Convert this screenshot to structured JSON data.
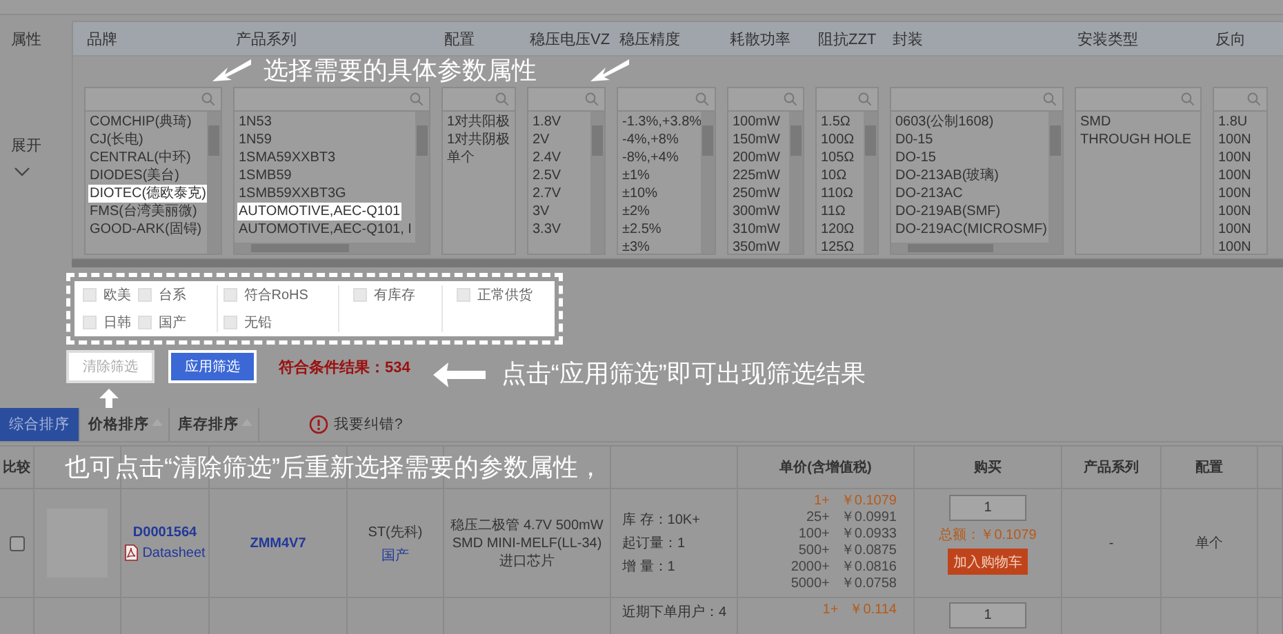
{
  "sidebar": {
    "attribute_label": "属性",
    "expand_label": "展开"
  },
  "filters": [
    {
      "heading": "品牌",
      "items": [
        {
          "label": "COMCHIP(典琦)",
          "selected": false
        },
        {
          "label": "CJ(长电)",
          "selected": false
        },
        {
          "label": "CENTRAL(中环)",
          "selected": false
        },
        {
          "label": "DIODES(美台)",
          "selected": false
        },
        {
          "label": "DIOTEC(德欧泰克)",
          "selected": true
        },
        {
          "label": "FMS(台湾美丽微)",
          "selected": false
        },
        {
          "label": "GOOD-ARK(固锝)",
          "selected": false
        }
      ]
    },
    {
      "heading": "产品系列",
      "items": [
        {
          "label": "1N53",
          "selected": false
        },
        {
          "label": "1N59",
          "selected": false
        },
        {
          "label": "1SMA59XXBT3",
          "selected": false
        },
        {
          "label": "1SMB59",
          "selected": false
        },
        {
          "label": "1SMB59XXBT3G",
          "selected": false
        },
        {
          "label": "AUTOMOTIVE,AEC-Q101",
          "selected": true
        },
        {
          "label": "AUTOMOTIVE,AEC-Q101, I",
          "selected": false
        }
      ]
    },
    {
      "heading": "配置",
      "items": [
        {
          "label": "1对共阳极",
          "selected": false
        },
        {
          "label": "1对共阴极",
          "selected": false
        },
        {
          "label": "单个",
          "selected": false
        }
      ]
    },
    {
      "heading": "稳压电压VZ",
      "items": [
        {
          "label": "1.8V",
          "selected": false
        },
        {
          "label": "2V",
          "selected": false
        },
        {
          "label": "2.4V",
          "selected": false
        },
        {
          "label": "2.5V",
          "selected": false
        },
        {
          "label": "2.7V",
          "selected": false
        },
        {
          "label": "3V",
          "selected": false
        },
        {
          "label": "3.3V",
          "selected": false
        }
      ]
    },
    {
      "heading": "稳压精度",
      "items": [
        {
          "label": "-1.3%,+3.8%",
          "selected": false
        },
        {
          "label": "-4%,+8%",
          "selected": false
        },
        {
          "label": "-8%,+4%",
          "selected": false
        },
        {
          "label": "±1%",
          "selected": false
        },
        {
          "label": "±10%",
          "selected": false
        },
        {
          "label": "±2%",
          "selected": false
        },
        {
          "label": "±2.5%",
          "selected": false
        },
        {
          "label": "±3%",
          "selected": false
        }
      ]
    },
    {
      "heading": "耗散功率",
      "items": [
        {
          "label": "100mW",
          "selected": false
        },
        {
          "label": "150mW",
          "selected": false
        },
        {
          "label": "200mW",
          "selected": false
        },
        {
          "label": "225mW",
          "selected": false
        },
        {
          "label": "250mW",
          "selected": false
        },
        {
          "label": "300mW",
          "selected": false
        },
        {
          "label": "310mW",
          "selected": false
        },
        {
          "label": "350mW",
          "selected": false
        }
      ]
    },
    {
      "heading": "阻抗ZZT",
      "items": [
        {
          "label": "1.5Ω",
          "selected": false
        },
        {
          "label": "100Ω",
          "selected": false
        },
        {
          "label": "105Ω",
          "selected": false
        },
        {
          "label": "10Ω",
          "selected": false
        },
        {
          "label": "110Ω",
          "selected": false
        },
        {
          "label": "11Ω",
          "selected": false
        },
        {
          "label": "120Ω",
          "selected": false
        },
        {
          "label": "125Ω",
          "selected": false
        }
      ]
    },
    {
      "heading": "封装",
      "items": [
        {
          "label": "0603(公制1608)",
          "selected": false
        },
        {
          "label": "D0-15",
          "selected": false
        },
        {
          "label": "DO-15",
          "selected": false
        },
        {
          "label": "DO-213AB(玻璃)",
          "selected": false
        },
        {
          "label": "DO-213AC",
          "selected": false
        },
        {
          "label": "DO-219AB(SMF)",
          "selected": false
        },
        {
          "label": "DO-219AC(MICROSMF)",
          "selected": false
        }
      ]
    },
    {
      "heading": "安装类型",
      "items": [
        {
          "label": "SMD",
          "selected": false
        },
        {
          "label": "THROUGH HOLE",
          "selected": false
        }
      ]
    },
    {
      "heading": "反向",
      "items": [
        {
          "label": "1.8U",
          "selected": false
        },
        {
          "label": "100N",
          "selected": false
        },
        {
          "label": "100N",
          "selected": false
        },
        {
          "label": "100N",
          "selected": false
        },
        {
          "label": "100N",
          "selected": false
        },
        {
          "label": "100N",
          "selected": false
        },
        {
          "label": "100N",
          "selected": false
        },
        {
          "label": "100N",
          "selected": false
        }
      ]
    }
  ],
  "options": [
    {
      "items": [
        {
          "label": "欧美",
          "checked": false
        },
        {
          "label": "台系",
          "checked": false
        },
        {
          "label": "日韩",
          "checked": false
        },
        {
          "label": "国产",
          "checked": false
        }
      ]
    },
    {
      "items": [
        {
          "label": "符合RoHS",
          "checked": false
        },
        {
          "label": "无铅",
          "checked": false
        }
      ]
    },
    {
      "items": [
        {
          "label": "有库存",
          "checked": false
        }
      ]
    },
    {
      "items": [
        {
          "label": "正常供货",
          "checked": false
        }
      ]
    }
  ],
  "buttons": [
    {
      "label": "清除筛选",
      "kind": "clear"
    },
    {
      "label": "应用筛选",
      "kind": "apply"
    }
  ],
  "result": "符合条件结果：534",
  "sort_tabs": [
    {
      "label": "综合排序",
      "selected": true
    },
    {
      "label": "价格排序",
      "selected": false
    },
    {
      "label": "库存排序",
      "selected": false
    }
  ],
  "report_link": "我要纠错?",
  "table": {
    "columns": [
      {
        "label": "比较"
      },
      {},
      {},
      {},
      {},
      {},
      {},
      {
        "label": "单价(含增值税)"
      },
      {
        "label": "购买"
      },
      {
        "label": "产品系列"
      },
      {
        "label": "配置"
      },
      {}
    ],
    "rows": [
      {
        "compare_checked": false,
        "part_no": "D0001564",
        "datasheet": "Datasheet",
        "model": "ZMM4V7",
        "brand": "ST(先科)",
        "origin": "国产",
        "description": "稳压二极管 4.7V 500mW SMD MINI-MELF(LL-34)进口芯片",
        "stock": [
          "库 存：10K+",
          "起订量：1",
          "增 量：1"
        ],
        "prices": [
          {
            "qty": "1+",
            "price": "￥0.1079",
            "highlight": true
          },
          {
            "qty": "25+",
            "price": "￥0.0991",
            "highlight": false
          },
          {
            "qty": "100+",
            "price": "￥0.0933",
            "highlight": false
          },
          {
            "qty": "500+",
            "price": "￥0.0875",
            "highlight": false
          },
          {
            "qty": "2000+",
            "price": "￥0.0816",
            "highlight": false
          },
          {
            "qty": "5000+",
            "price": "￥0.0758",
            "highlight": false
          }
        ],
        "quantity": "1",
        "total": "总额：￥0.1079",
        "cart_button": "加入购物车",
        "series": "-",
        "config": "单个"
      },
      {
        "stock": [
          "近期下单用户：4"
        ],
        "prices": [
          {
            "qty": "1+",
            "price": "￥0.114",
            "highlight": true
          }
        ],
        "quantity": "1"
      }
    ]
  },
  "annotations": [
    "选择需要的具体参数属性",
    "点击“应用筛选”即可出现筛选结果",
    "也可点击“清除筛选”后重新选择需要的参数属性，"
  ]
}
